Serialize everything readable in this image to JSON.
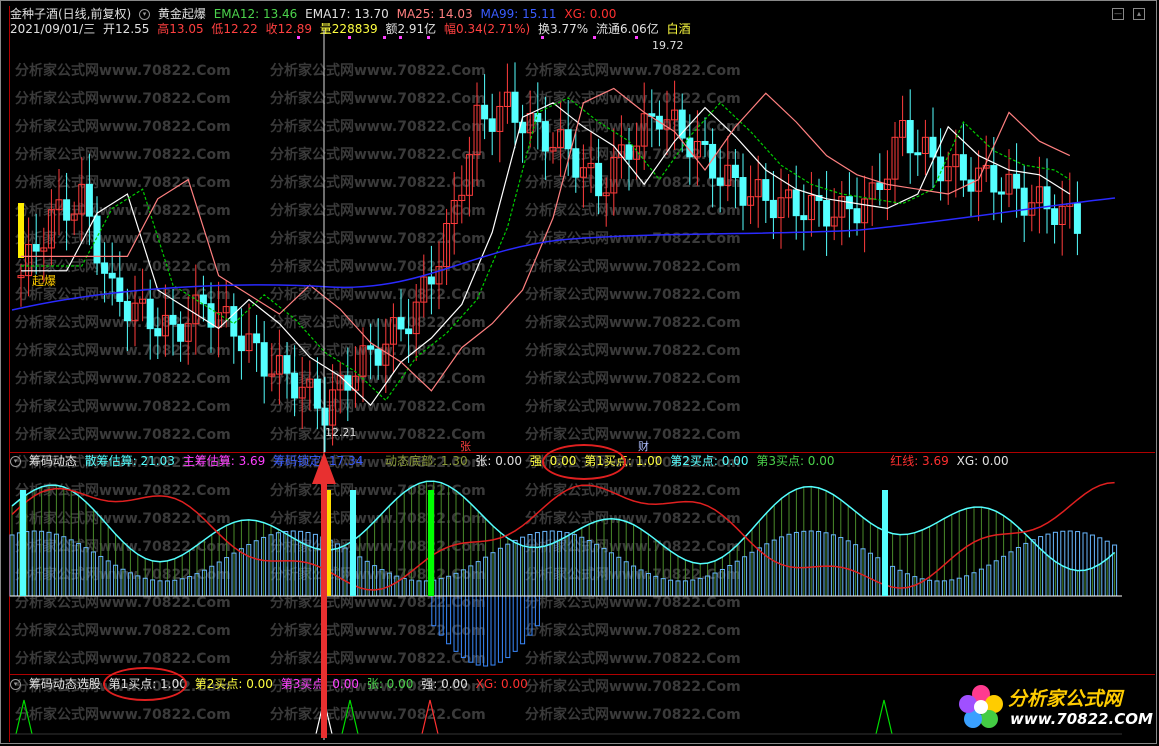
{
  "header": {
    "stock": "金种子酒(日线,前复权)",
    "indicator": "黄金起爆",
    "ema12": "EMA12: 13.46",
    "ema17": "EMA17: 13.70",
    "ma25": "MA25: 14.03",
    "ma99": "MA99: 15.11",
    "xg": "XG: 0.00"
  },
  "info": {
    "date": "2021/09/01/三",
    "open": "开12.55",
    "high": "高13.05",
    "low": "低12.22",
    "close": "收12.89",
    "volume": "量228839",
    "amount": "额2.91亿",
    "change": "幅0.34(2.71%)",
    "turnover": "换3.77%",
    "float": "流通6.06亿",
    "sector": "白酒"
  },
  "price_labels": {
    "high_label": "19.72",
    "low_label": "12.21",
    "qibao": "起爆"
  },
  "markers": {
    "zhang": "张",
    "cai": "财"
  },
  "panel2": {
    "title": "筹码动态",
    "sanchou": "散筹估算: 21.03",
    "zhuchou": "主筹估算: 3.69",
    "suoding": "筹码锁定: 17.34",
    "dibu": "动态底部: 1.30",
    "zhang": "张: 0.00",
    "qiang": "强: 0.00",
    "buy1": "第1买点: 1.00",
    "buy2": "第2买点: 0.00",
    "buy3": "第3买点: 0.00",
    "hongxian": "红线: 3.69",
    "xg": "XG: 0.00"
  },
  "panel3": {
    "title": "筹码动态选股",
    "buy1": "第1买点: 1.00",
    "buy2": "第2买点: 0.00",
    "buy3": "第3买点: 0.00",
    "zhang": "张: 0.00",
    "qiang": "强: 0.00",
    "xg": "XG: 0.00"
  },
  "watermark": "分析家公式网www.70822.Com",
  "logo": {
    "name": "分析家公式网",
    "url": "www.70822.COM"
  },
  "colors": {
    "up": "#ff3c3c",
    "down": "#54ffff",
    "ema12": "#ffffff",
    "ema17": "#00cc00",
    "ma25": "#ff8080",
    "ma99": "#2a2aff",
    "accent_red": "#e02020"
  }
}
